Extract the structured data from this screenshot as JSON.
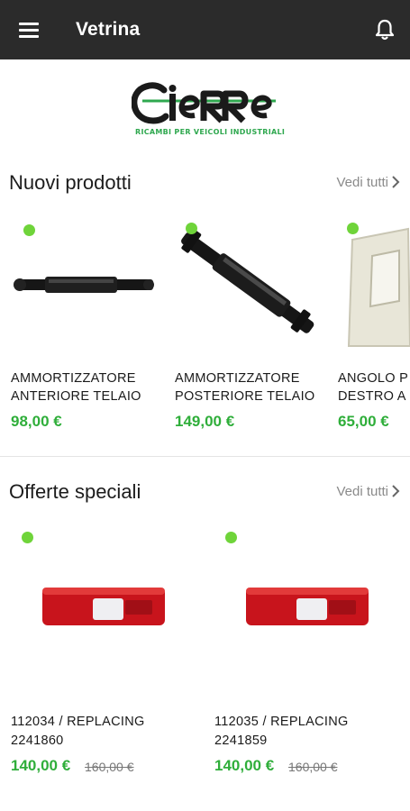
{
  "appbar": {
    "title": "Vetrina",
    "menu_icon": "hamburger-menu-icon",
    "bell_icon": "notification-bell-icon",
    "background": "#2b2b2b"
  },
  "logo": {
    "name": "CieRRe",
    "tagline": "RICAMBI PER VEICOLI INDUSTRIALI"
  },
  "new_products": {
    "title": "Nuovi prodotti",
    "see_all": "Vedi tutti",
    "items": [
      {
        "name_line1": "AMMORTIZZATORE",
        "name_line2": "ANTERIORE TELAIO",
        "price": "98,00 €",
        "image": "shock-absorber-horizontal"
      },
      {
        "name_line1": "AMMORTIZZATORE",
        "name_line2": "POSTERIORE TELAIO",
        "price": "149,00 €",
        "image": "shock-absorber-diagonal"
      },
      {
        "name_line1": "ANGOLO P",
        "name_line2": "DESTRO A",
        "price": "65,00 €",
        "image": "cab-corner-panel"
      }
    ]
  },
  "special_offers": {
    "title": "Offerte speciali",
    "see_all": "Vedi tutti",
    "items": [
      {
        "name_line1": "112034 / REPLACING",
        "name_line2": "2241860",
        "price": "140,00 €",
        "old_price": "160,00 €",
        "image": "rear-tail-light"
      },
      {
        "name_line1": "112035 / REPLACING",
        "name_line2": "2241859",
        "price": "140,00 €",
        "old_price": "160,00 €",
        "image": "rear-tail-light"
      }
    ]
  },
  "colors": {
    "accent_green": "#2fae3a",
    "new_dot": "#6fd43a"
  }
}
